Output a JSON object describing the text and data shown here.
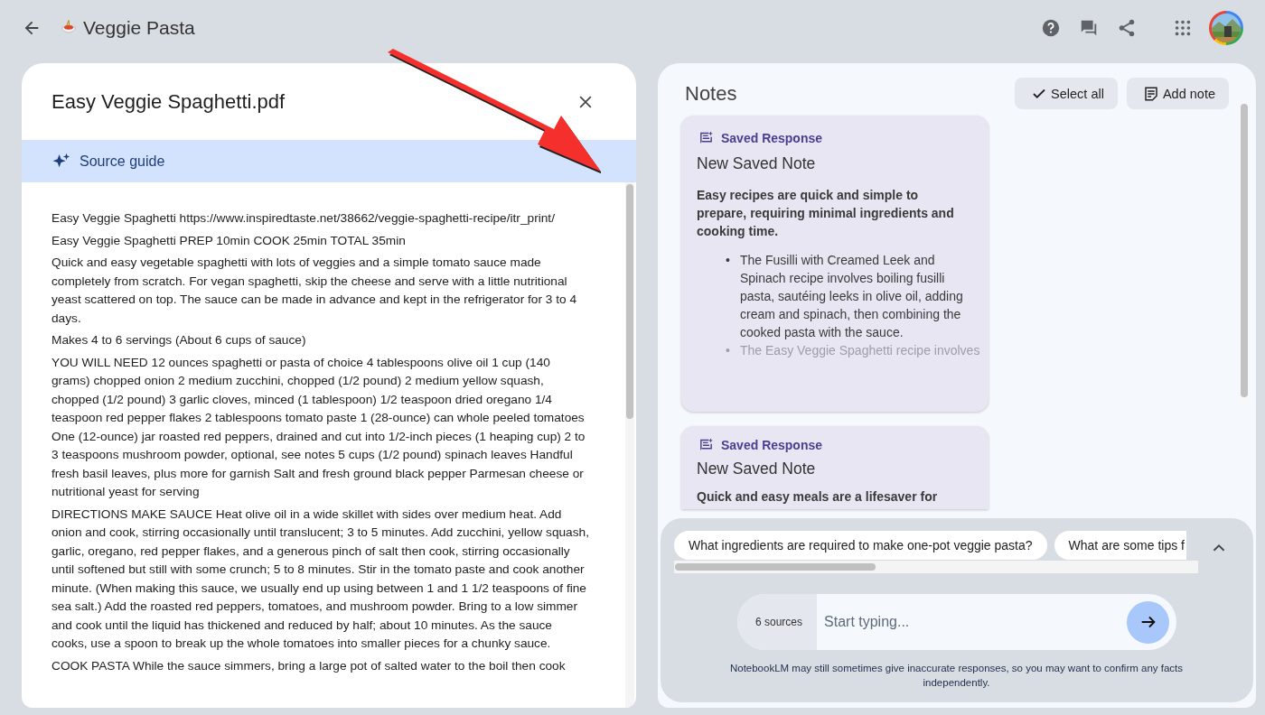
{
  "header": {
    "title": "Veggie Pasta"
  },
  "source": {
    "title": "Easy Veggie Spaghetti.pdf",
    "guide": "Source guide",
    "paragraphs": [
      "Easy Veggie Spaghetti https://www.inspiredtaste.net/38662/veggie-spaghetti-recipe/itr_print/",
      "Easy Veggie Spaghetti PREP 10min COOK 25min TOTAL 35min",
      "Quick and easy vegetable spaghetti with lots of veggies and a simple tomato sauce made completely from scratch. For vegan spaghetti, skip the cheese and serve with a little nutritional yeast scattered on top. The sauce can be made in advance and kept in the refrigerator for 3 to 4 days.",
      "Makes 4 to 6 servings (About 6 cups of sauce)",
      "YOU WILL NEED 12 ounces spaghetti or pasta of choice 4 tablespoons olive oil 1 cup (140 grams) chopped onion 2 medium zucchini, chopped (1/2 pound) 2 medium yellow squash, chopped (1/2 pound) 3 garlic cloves, minced (1 tablespoon) 1/2 teaspoon dried oregano 1/4 teaspoon red pepper flakes 2 tablespoons tomato paste 1 (28-ounce) can whole peeled tomatoes One (12-ounce) jar roasted red peppers, drained and cut into 1/2-inch pieces (1 heaping cup) 2 to 3 teaspoons mushroom powder, optional, see notes 5 cups (1/2 pound) spinach leaves Handful fresh basil leaves, plus more for garnish Salt and fresh ground black pepper Parmesan cheese or nutritional yeast for serving",
      "DIRECTIONS MAKE SAUCE Heat olive oil in a wide skillet with sides over medium heat. Add onion and cook, stirring occasionally until translucent; 3 to 5 minutes. Add zucchini, yellow squash, garlic, oregano, red pepper flakes, and a generous pinch of salt then cook, stirring occasionally until softened but still with some crunch; 5 to 8 minutes. Stir in the tomato paste and cook another minute. (When making this sauce, we usually end up using between 1 and 1 1/2 teaspoons of fine sea salt.) Add the roasted red peppers, tomatoes, and mushroom powder. Bring to a low simmer and cook until the liquid has thickened and reduced by half; about 10 minutes. As the sauce cooks, use a spoon to break up the whole tomatoes into smaller pieces for a chunky sauce.",
      "COOK PASTA While the sauce simmers, bring a large pot of salted water to the boil then cook"
    ]
  },
  "notes": {
    "title": "Notes",
    "actions": [
      {
        "label": "Select all",
        "kind": "select"
      },
      {
        "label": "Add note",
        "kind": "add"
      }
    ],
    "cards": [
      {
        "tag": "Saved Response",
        "title": "New Saved Note",
        "summary": "Easy recipes are quick and simple to prepare, requiring minimal ingredients and cooking time.",
        "bullet_marker": "•",
        "bullets": [
          "The Fusilli with Creamed Leek and Spinach recipe involves boiling fusilli pasta, sautéing leeks in olive oil, adding cream and spinach, then combining the cooked pasta with the sauce.",
          "The Easy Veggie Spaghetti recipe involves"
        ]
      },
      {
        "tag": "Saved Response",
        "title": "New Saved Note",
        "summary": "Quick and easy meals are a lifesaver for"
      }
    ]
  },
  "chat": {
    "suggestions": [
      "What ingredients are required to make one-pot veggie pasta?",
      "What are some tips f"
    ],
    "sources": "6 sources",
    "placeholder": "Start typing...",
    "disclaimer": "NotebookLM may still sometimes give inaccurate responses, so you may want to confirm any facts independently."
  }
}
